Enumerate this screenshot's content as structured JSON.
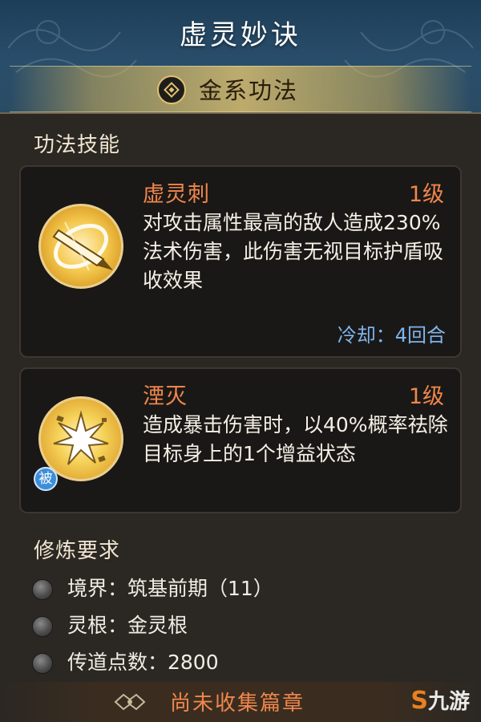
{
  "header": {
    "title": "虚灵妙诀",
    "element_label": "金系功法"
  },
  "skills_section": {
    "title": "功法技能",
    "skills": [
      {
        "name": "虚灵刺",
        "level": "1级",
        "description": "对攻击属性最高的敌人造成230%法术伤害，此伤害无视目标护盾吸收效果",
        "cooldown": "冷却：4回合",
        "icon": "golden-orbit-sword-icon"
      },
      {
        "name": "湮灭",
        "level": "1级",
        "description": "造成暴击伤害时，以40%概率祛除目标身上的1个增益状态",
        "badge": "被",
        "icon": "golden-burst-icon"
      }
    ]
  },
  "requirements": {
    "title": "修炼要求",
    "items": [
      "境界：筑基前期（11）",
      "灵根：金灵根",
      "传道点数：2800"
    ]
  },
  "footer": {
    "label": "尚未收集篇章",
    "icon": "scroll-chapter-icon"
  },
  "watermark": {
    "symbol": "S",
    "text": "九游"
  },
  "colors": {
    "header_bg": "#294e6b",
    "skill_name": "#f0864c",
    "cooldown": "#7fb4ec",
    "card_bg": "#1a1816",
    "gold": "#e2c170"
  }
}
